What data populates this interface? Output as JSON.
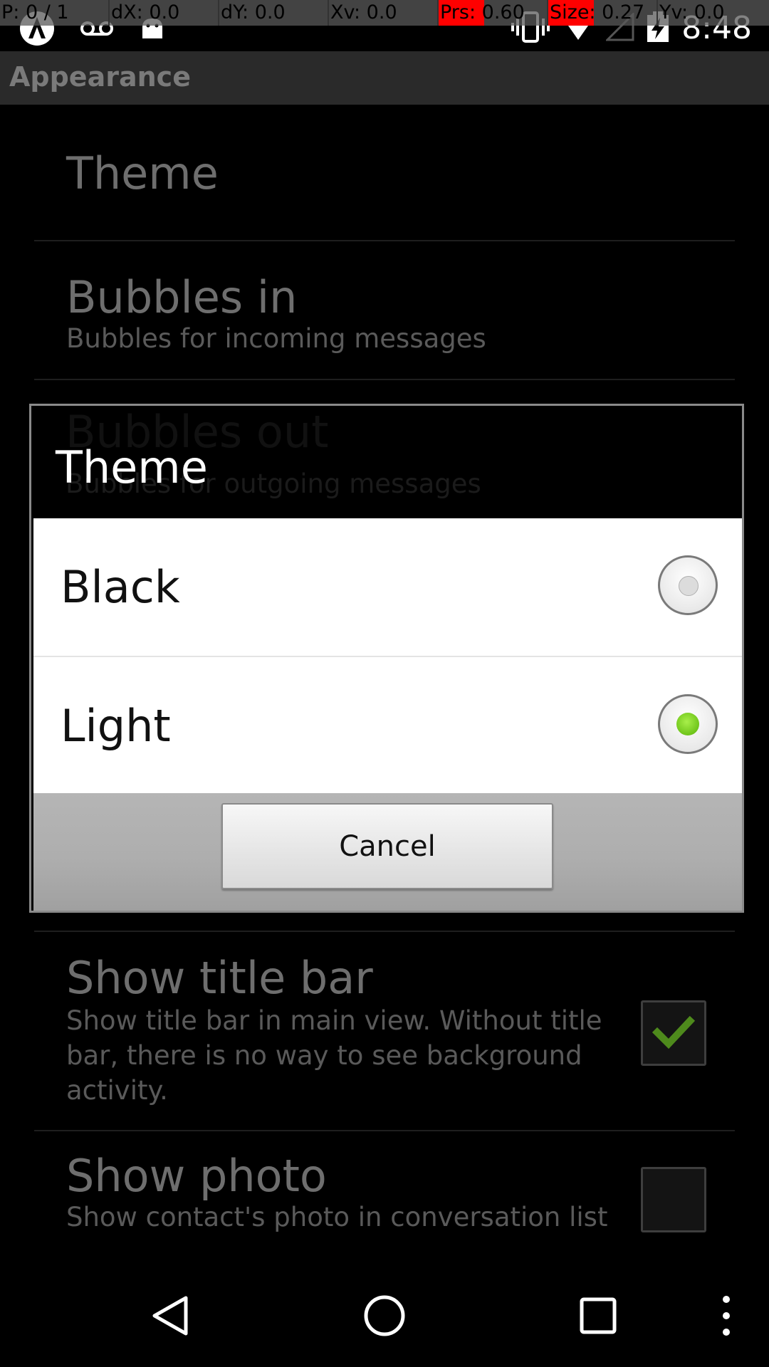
{
  "debug_overlay": {
    "pointer": "P: 0 / 1",
    "dx": "dX: 0.0",
    "dy": "dY: 0.0",
    "xv": "Xv: 0.0",
    "yv": "Yv: 0.0",
    "prs": "Prs: 0.60",
    "size": "Size: 0.27",
    "highlight_color": "#ff0000"
  },
  "status_bar": {
    "time": "8:48",
    "left_icons": [
      "app-notification-icon",
      "voicemail-icon",
      "android-icon"
    ],
    "right_icons": [
      "vibrate-icon",
      "wifi-icon",
      "signal-icon",
      "battery-charging-icon"
    ]
  },
  "action_bar": {
    "title": "Appearance"
  },
  "preferences": [
    {
      "title": "Theme",
      "summary": ""
    },
    {
      "title": "Bubbles in",
      "summary": "Bubbles for incoming messages"
    },
    {
      "title": "Bubbles out",
      "summary": "Bubbles for outgoing messages"
    },
    {
      "title": "Show title bar",
      "summary": "Show title bar in main view. Without title bar, there is no way to see background activity.",
      "checked": true
    },
    {
      "title": "Show photo",
      "summary": "Show contact's photo in conversation list",
      "checked": false
    }
  ],
  "dialog": {
    "title": "Theme",
    "options": [
      {
        "label": "Black",
        "selected": false
      },
      {
        "label": "Light",
        "selected": true
      }
    ],
    "cancel_label": "Cancel",
    "accent_color": "#6fc51a"
  },
  "nav_bar": {
    "icons": [
      "back-icon",
      "home-icon",
      "recents-icon",
      "overflow-menu-icon"
    ]
  }
}
